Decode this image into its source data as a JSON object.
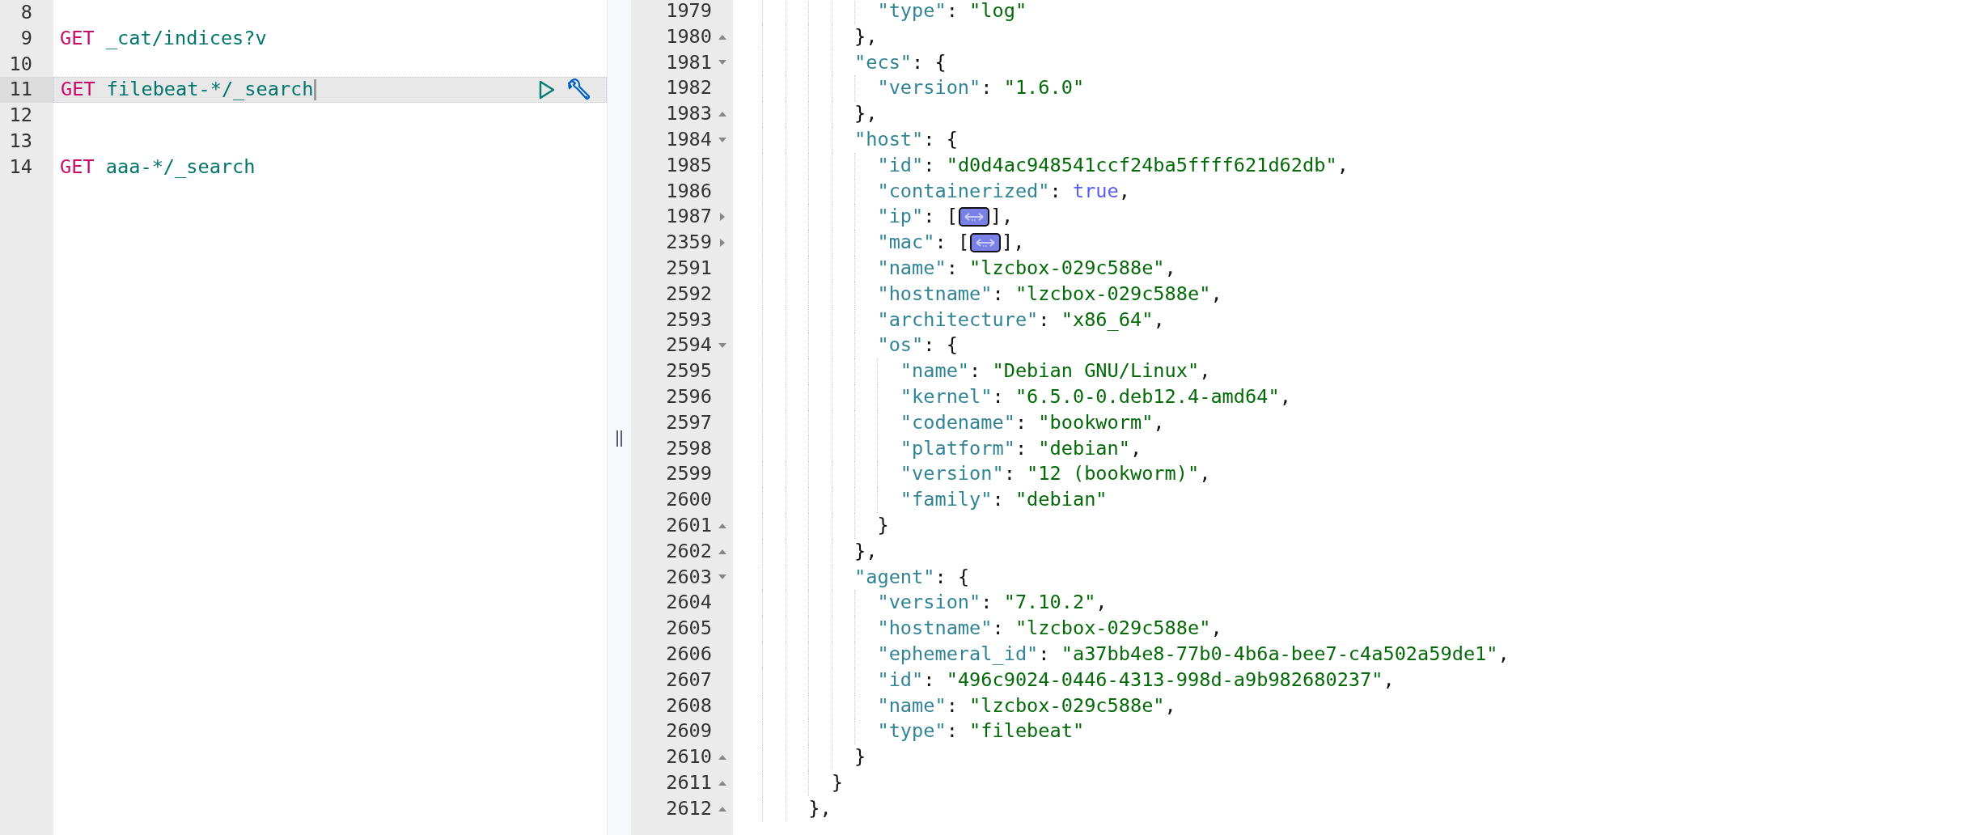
{
  "request_editor": {
    "lines": [
      {
        "number": "8",
        "selected": false
      },
      {
        "number": "9",
        "selected": false,
        "method": "GET",
        "path": "_cat/indices?v"
      },
      {
        "number": "10",
        "selected": false
      },
      {
        "number": "11",
        "selected": true,
        "method": "GET",
        "path": "filebeat-*/_search"
      },
      {
        "number": "12",
        "selected": false
      },
      {
        "number": "13",
        "selected": false
      },
      {
        "number": "14",
        "selected": false,
        "method": "GET",
        "path": "aaa-*/_search"
      }
    ]
  },
  "response_viewer": {
    "lines": [
      {
        "children": [
          {
            "children": [
              {
                "children": [
                  {
                    "number": "1979",
                    "kind": "plain",
                    "tokens": [
                      {
                        "kind": "key",
                        "text": "\"type\""
                      },
                      {
                        "kind": "punct",
                        "text": ": "
                      },
                      {
                        "kind": "string",
                        "text": "\"log\""
                      }
                    ]
                  }
                ]
              },
              {
                "number": "1980",
                "kind": "fold_end",
                "tokens": [
                  {
                    "kind": "punct",
                    "text": "},"
                  }
                ]
              },
              {
                "number": "1981",
                "kind": "fold_open",
                "tokens": [
                  {
                    "kind": "key",
                    "text": "\"ecs\""
                  },
                  {
                    "kind": "punct",
                    "text": ": {"
                  }
                ],
                "children": [
                  {
                    "number": "1982",
                    "kind": "plain",
                    "tokens": [
                      {
                        "kind": "key",
                        "text": "\"version\""
                      },
                      {
                        "kind": "punct",
                        "text": ": "
                      },
                      {
                        "kind": "string",
                        "text": "\"1.6.0\""
                      }
                    ]
                  }
                ]
              },
              {
                "number": "1983",
                "kind": "fold_end",
                "tokens": [
                  {
                    "kind": "punct",
                    "text": "},"
                  }
                ]
              },
              {
                "number": "1984",
                "kind": "fold_open",
                "tokens": [
                  {
                    "kind": "key",
                    "text": "\"host\""
                  },
                  {
                    "kind": "punct",
                    "text": ": {"
                  }
                ],
                "children": [
                  {
                    "number": "1985",
                    "kind": "plain",
                    "tokens": [
                      {
                        "kind": "key",
                        "text": "\"id\""
                      },
                      {
                        "kind": "punct",
                        "text": ": "
                      },
                      {
                        "kind": "string",
                        "text": "\"d0d4ac948541ccf24ba5ffff621d62db\""
                      },
                      {
                        "kind": "punct",
                        "text": ","
                      }
                    ]
                  },
                  {
                    "number": "1986",
                    "kind": "plain",
                    "tokens": [
                      {
                        "kind": "key",
                        "text": "\"containerized\""
                      },
                      {
                        "kind": "punct",
                        "text": ": "
                      },
                      {
                        "kind": "bool",
                        "text": "true"
                      },
                      {
                        "kind": "punct",
                        "text": ","
                      }
                    ]
                  },
                  {
                    "number": "1987",
                    "kind": "collapsed",
                    "tokens": [
                      {
                        "kind": "key",
                        "text": "\"ip\""
                      },
                      {
                        "kind": "punct",
                        "text": ": ["
                      },
                      {
                        "kind": "collapsed"
                      },
                      {
                        "kind": "punct",
                        "text": "],"
                      }
                    ]
                  },
                  {
                    "number": "2359",
                    "kind": "collapsed",
                    "tokens": [
                      {
                        "kind": "key",
                        "text": "\"mac\""
                      },
                      {
                        "kind": "punct",
                        "text": ": ["
                      },
                      {
                        "kind": "collapsed"
                      },
                      {
                        "kind": "punct",
                        "text": "],"
                      }
                    ]
                  },
                  {
                    "number": "2591",
                    "kind": "plain",
                    "tokens": [
                      {
                        "kind": "key",
                        "text": "\"name\""
                      },
                      {
                        "kind": "punct",
                        "text": ": "
                      },
                      {
                        "kind": "string",
                        "text": "\"lzcbox-029c588e\""
                      },
                      {
                        "kind": "punct",
                        "text": ","
                      }
                    ]
                  },
                  {
                    "number": "2592",
                    "kind": "plain",
                    "tokens": [
                      {
                        "kind": "key",
                        "text": "\"hostname\""
                      },
                      {
                        "kind": "punct",
                        "text": ": "
                      },
                      {
                        "kind": "string",
                        "text": "\"lzcbox-029c588e\""
                      },
                      {
                        "kind": "punct",
                        "text": ","
                      }
                    ]
                  },
                  {
                    "number": "2593",
                    "kind": "plain",
                    "tokens": [
                      {
                        "kind": "key",
                        "text": "\"architecture\""
                      },
                      {
                        "kind": "punct",
                        "text": ": "
                      },
                      {
                        "kind": "string",
                        "text": "\"x86_64\""
                      },
                      {
                        "kind": "punct",
                        "text": ","
                      }
                    ]
                  },
                  {
                    "number": "2594",
                    "kind": "fold_open",
                    "tokens": [
                      {
                        "kind": "key",
                        "text": "\"os\""
                      },
                      {
                        "kind": "punct",
                        "text": ": {"
                      }
                    ],
                    "children": [
                      {
                        "number": "2595",
                        "kind": "plain",
                        "tokens": [
                          {
                            "kind": "key",
                            "text": "\"name\""
                          },
                          {
                            "kind": "punct",
                            "text": ": "
                          },
                          {
                            "kind": "string",
                            "text": "\"Debian GNU/Linux\""
                          },
                          {
                            "kind": "punct",
                            "text": ","
                          }
                        ]
                      },
                      {
                        "number": "2596",
                        "kind": "plain",
                        "tokens": [
                          {
                            "kind": "key",
                            "text": "\"kernel\""
                          },
                          {
                            "kind": "punct",
                            "text": ": "
                          },
                          {
                            "kind": "string",
                            "text": "\"6.5.0-0.deb12.4-amd64\""
                          },
                          {
                            "kind": "punct",
                            "text": ","
                          }
                        ]
                      },
                      {
                        "number": "2597",
                        "kind": "plain",
                        "tokens": [
                          {
                            "kind": "key",
                            "text": "\"codename\""
                          },
                          {
                            "kind": "punct",
                            "text": ": "
                          },
                          {
                            "kind": "string",
                            "text": "\"bookworm\""
                          },
                          {
                            "kind": "punct",
                            "text": ","
                          }
                        ]
                      },
                      {
                        "number": "2598",
                        "kind": "plain",
                        "tokens": [
                          {
                            "kind": "key",
                            "text": "\"platform\""
                          },
                          {
                            "kind": "punct",
                            "text": ": "
                          },
                          {
                            "kind": "string",
                            "text": "\"debian\""
                          },
                          {
                            "kind": "punct",
                            "text": ","
                          }
                        ]
                      },
                      {
                        "number": "2599",
                        "kind": "plain",
                        "tokens": [
                          {
                            "kind": "key",
                            "text": "\"version\""
                          },
                          {
                            "kind": "punct",
                            "text": ": "
                          },
                          {
                            "kind": "string",
                            "text": "\"12 (bookworm)\""
                          },
                          {
                            "kind": "punct",
                            "text": ","
                          }
                        ]
                      },
                      {
                        "number": "2600",
                        "kind": "plain",
                        "tokens": [
                          {
                            "kind": "key",
                            "text": "\"family\""
                          },
                          {
                            "kind": "punct",
                            "text": ": "
                          },
                          {
                            "kind": "string",
                            "text": "\"debian\""
                          }
                        ]
                      }
                    ]
                  },
                  {
                    "number": "2601",
                    "kind": "fold_end",
                    "tokens": [
                      {
                        "kind": "punct",
                        "text": "}"
                      }
                    ]
                  }
                ]
              },
              {
                "number": "2602",
                "kind": "fold_end",
                "tokens": [
                  {
                    "kind": "punct",
                    "text": "},"
                  }
                ]
              },
              {
                "number": "2603",
                "kind": "fold_open",
                "tokens": [
                  {
                    "kind": "key",
                    "text": "\"agent\""
                  },
                  {
                    "kind": "punct",
                    "text": ": {"
                  }
                ],
                "children": [
                  {
                    "number": "2604",
                    "kind": "plain",
                    "tokens": [
                      {
                        "kind": "key",
                        "text": "\"version\""
                      },
                      {
                        "kind": "punct",
                        "text": ": "
                      },
                      {
                        "kind": "string",
                        "text": "\"7.10.2\""
                      },
                      {
                        "kind": "punct",
                        "text": ","
                      }
                    ]
                  },
                  {
                    "number": "2605",
                    "kind": "plain",
                    "tokens": [
                      {
                        "kind": "key",
                        "text": "\"hostname\""
                      },
                      {
                        "kind": "punct",
                        "text": ": "
                      },
                      {
                        "kind": "string",
                        "text": "\"lzcbox-029c588e\""
                      },
                      {
                        "kind": "punct",
                        "text": ","
                      }
                    ]
                  },
                  {
                    "number": "2606",
                    "kind": "plain",
                    "tokens": [
                      {
                        "kind": "key",
                        "text": "\"ephemeral_id\""
                      },
                      {
                        "kind": "punct",
                        "text": ": "
                      },
                      {
                        "kind": "string",
                        "text": "\"a37bb4e8-77b0-4b6a-bee7-c4a502a59de1\""
                      },
                      {
                        "kind": "punct",
                        "text": ","
                      }
                    ]
                  },
                  {
                    "number": "2607",
                    "kind": "plain",
                    "tokens": [
                      {
                        "kind": "key",
                        "text": "\"id\""
                      },
                      {
                        "kind": "punct",
                        "text": ": "
                      },
                      {
                        "kind": "string",
                        "text": "\"496c9024-0446-4313-998d-a9b982680237\""
                      },
                      {
                        "kind": "punct",
                        "text": ","
                      }
                    ]
                  },
                  {
                    "number": "2608",
                    "kind": "plain",
                    "tokens": [
                      {
                        "kind": "key",
                        "text": "\"name\""
                      },
                      {
                        "kind": "punct",
                        "text": ": "
                      },
                      {
                        "kind": "string",
                        "text": "\"lzcbox-029c588e\""
                      },
                      {
                        "kind": "punct",
                        "text": ","
                      }
                    ]
                  },
                  {
                    "number": "2609",
                    "kind": "plain",
                    "tokens": [
                      {
                        "kind": "key",
                        "text": "\"type\""
                      },
                      {
                        "kind": "punct",
                        "text": ": "
                      },
                      {
                        "kind": "string",
                        "text": "\"filebeat\""
                      }
                    ]
                  }
                ]
              },
              {
                "number": "2610",
                "kind": "fold_end",
                "tokens": [
                  {
                    "kind": "punct",
                    "text": "}"
                  }
                ]
              }
            ]
          },
          {
            "number": "2611",
            "kind": "fold_end",
            "tokens": [
              {
                "kind": "punct",
                "text": "}"
              }
            ]
          }
        ]
      },
      {
        "number": "2612",
        "kind": "fold_end",
        "tokens": [
          {
            "kind": "punct",
            "text": "},"
          }
        ]
      }
    ]
  }
}
